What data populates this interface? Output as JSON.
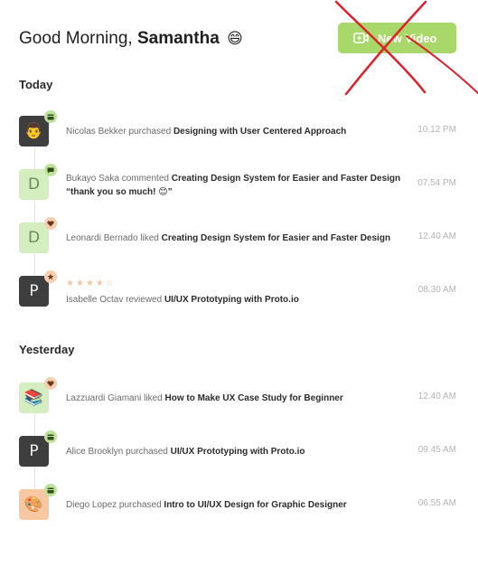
{
  "header": {
    "greeting": "Good Morning,",
    "user_name": "Samantha",
    "emoji": "😄",
    "new_video_label": "New Video"
  },
  "colors": {
    "accent_green": "#a9d86a",
    "badge_green": "#bde39a",
    "badge_peach": "#f6cfb1",
    "cross_red": "#e0202c"
  },
  "sections": [
    {
      "title": "Today",
      "items": [
        {
          "actor": "Nicolas Bekker",
          "action": "purchased",
          "course": "Designing with User Centered Approach",
          "time": "10.12 PM",
          "avatar": "👨",
          "avatar_style": "dark",
          "badge_icon": "card-icon"
        },
        {
          "actor": "Bukayo Saka",
          "action": "commented",
          "course": "Creating Design System for Easier and Faster Design",
          "comment": "“thank you so much! 😊”",
          "time": "07.54 PM",
          "avatar": "D",
          "avatar_style": "green",
          "badge_icon": "comment-icon"
        },
        {
          "actor": "Leonardi Bernado",
          "action": "liked",
          "course": "Creating Design System for Easier and Faster Design",
          "time": "12.40 AM",
          "avatar": "D",
          "avatar_style": "green",
          "badge_icon": "heart-icon"
        },
        {
          "actor": "Isabelle Octav",
          "action": "reviewed",
          "course": "UI/UX Prototyping with Proto.io",
          "time": "08.30 AM",
          "avatar": "P",
          "avatar_style": "dark",
          "badge_icon": "star-icon",
          "stars": "★★★★☆"
        }
      ]
    },
    {
      "title": "Yesterday",
      "items": [
        {
          "actor": "Lazzuardi Giamani",
          "action": "liked",
          "course": "How to Make UX Case Study for Beginner",
          "time": "12.40 AM",
          "avatar": "📚",
          "avatar_style": "green",
          "badge_icon": "heart-icon"
        },
        {
          "actor": "Alice Brooklyn",
          "action": "purchased",
          "course": "UI/UX Prototyping with Proto.io",
          "time": "09.45 AM",
          "avatar": "P",
          "avatar_style": "dark",
          "badge_icon": "card-icon"
        },
        {
          "actor": "Diego Lopez",
          "action": "purchased",
          "course": "Intro to UI/UX Design for Graphic Designer",
          "time": "06.55 AM",
          "avatar": "🎨",
          "avatar_style": "peach",
          "badge_icon": "card-icon"
        }
      ]
    }
  ]
}
